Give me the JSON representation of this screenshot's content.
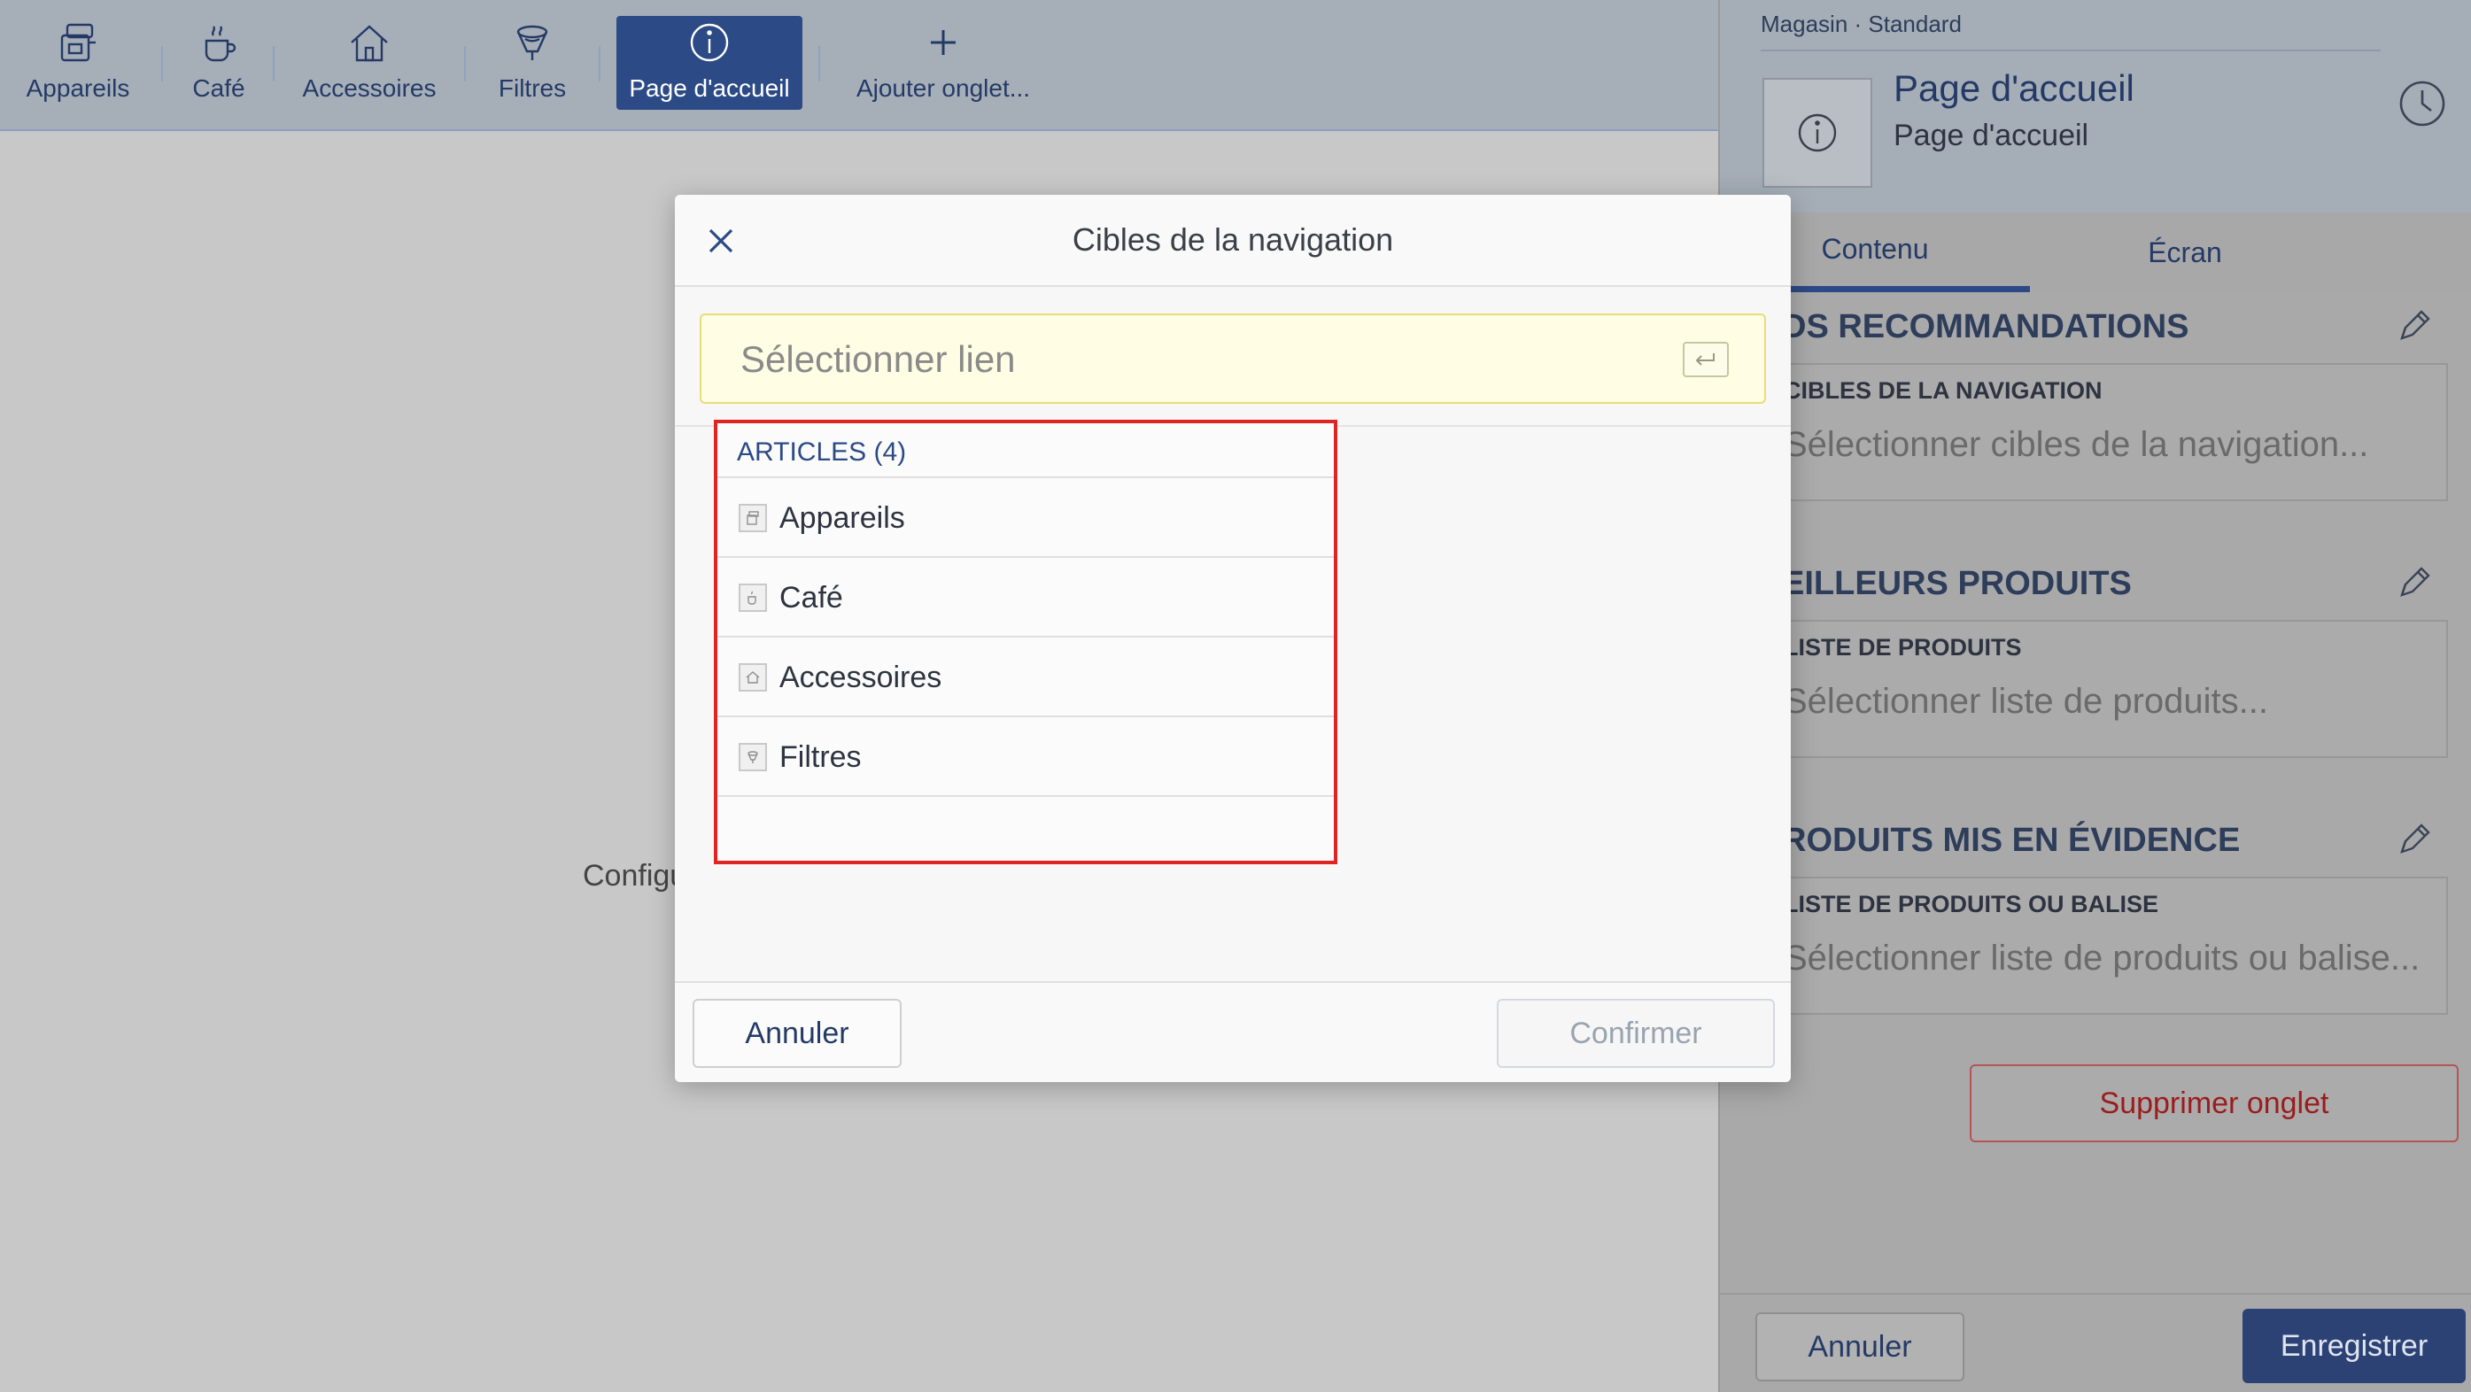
{
  "topbar": {
    "tabs": [
      {
        "label": "Appareils",
        "icon": "appliances-icon"
      },
      {
        "label": "Café",
        "icon": "coffee-cup-icon"
      },
      {
        "label": "Accessoires",
        "icon": "house-icon"
      },
      {
        "label": "Filtres",
        "icon": "filter-icon"
      },
      {
        "label": "Page d'accueil",
        "icon": "info-icon",
        "active": true
      }
    ],
    "add_tab_label": "Ajouter onglet..."
  },
  "canvas": {
    "partial_text": "Configu"
  },
  "right_panel": {
    "breadcrumb": "Magasin · Standard",
    "title": "Page d'accueil",
    "subtitle": "Page d'accueil",
    "tabs": [
      {
        "label": "Contenu",
        "selected": true
      },
      {
        "label": "Écran",
        "selected": false
      }
    ],
    "sections": [
      {
        "title": "DS RECOMMANDATIONS",
        "field_label": "CIBLES DE LA NAVIGATION",
        "placeholder": "Sélectionner cibles de la navigation..."
      },
      {
        "title": "EILLEURS PRODUITS",
        "field_label": "LISTE DE PRODUITS",
        "placeholder": "Sélectionner liste de produits..."
      },
      {
        "title": "RODUITS MIS EN ÉVIDENCE",
        "field_label": "LISTE DE PRODUITS OU BALISE",
        "placeholder": "Sélectionner liste de produits ou balise..."
      }
    ],
    "delete_tab_label": "Supprimer onglet",
    "cancel_label": "Annuler",
    "save_label": "Enregistrer"
  },
  "modal": {
    "title": "Cibles de la navigation",
    "search_placeholder": "Sélectionner lien",
    "dropdown": {
      "header": "ARTICLES (4)",
      "items": [
        "Appareils",
        "Café",
        "Accessoires",
        "Filtres"
      ]
    },
    "cancel_label": "Annuler",
    "confirm_label": "Confirmer"
  },
  "colors": {
    "brand": "#2c4a86",
    "highlight": "#e02424",
    "delete": "#9b1c1c",
    "input_bg": "#fffde3"
  }
}
